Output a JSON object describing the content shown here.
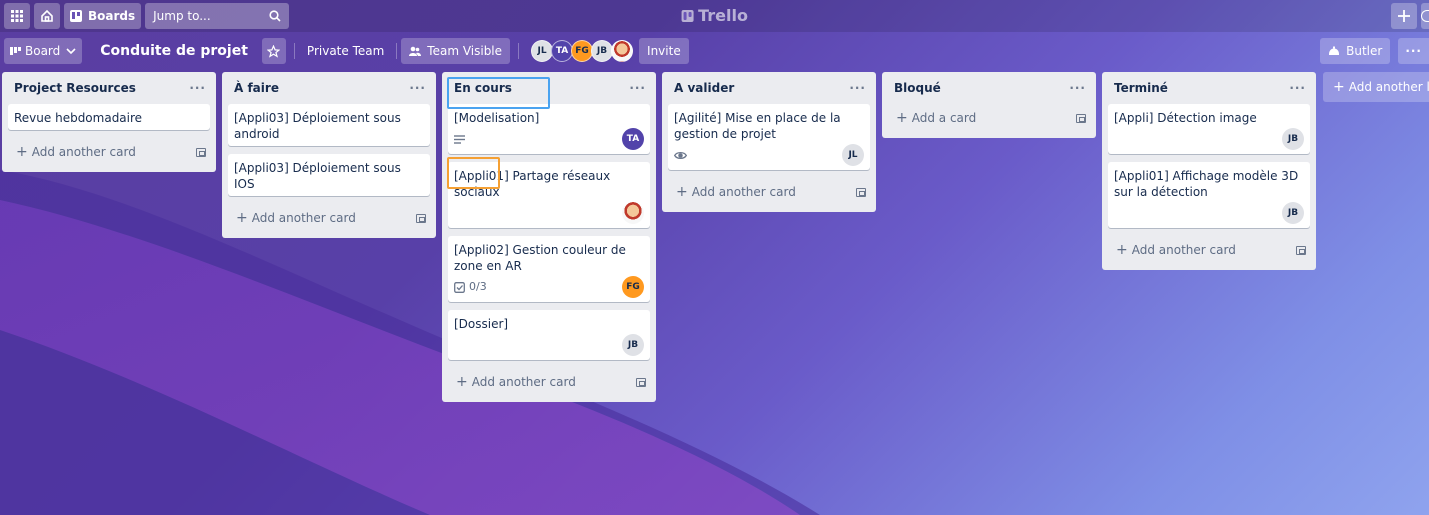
{
  "topbar": {
    "boards_label": "Boards",
    "search_placeholder": "Jump to...",
    "logo_text": "Trello"
  },
  "board": {
    "view_label": "Board",
    "title": "Conduite de projet",
    "team_label": "Private Team",
    "visibility_label": "Team Visible",
    "invite_label": "Invite",
    "butler_label": "Butler",
    "members": [
      "JL",
      "TA",
      "FG",
      "JB"
    ]
  },
  "lists": [
    {
      "title": "Project Resources",
      "cards": [
        {
          "title": "Revue hebdomadaire"
        }
      ],
      "add_label": "Add another card"
    },
    {
      "title": "À faire",
      "cards": [
        {
          "title": "[Appli03] Déploiement sous android"
        },
        {
          "title": "[Appli03] Déploiement sous IOS"
        }
      ],
      "add_label": "Add another card"
    },
    {
      "title": "En cours",
      "cards": [
        {
          "title": "[Modelisation]",
          "member": "TA"
        },
        {
          "title": "[Appli01] Partage réseaux sociaux"
        },
        {
          "title": "[Appli02] Gestion couleur de zone en AR",
          "checklist": "0/3",
          "member": "FG"
        },
        {
          "title": "[Dossier]",
          "member": "JB"
        }
      ],
      "add_label": "Add another card"
    },
    {
      "title": "A valider",
      "cards": [
        {
          "title": "[Agilité] Mise en place de la gestion de projet",
          "member": "JL"
        }
      ],
      "add_label": "Add another card"
    },
    {
      "title": "Bloqué",
      "cards": [],
      "add_label": "Add a card"
    },
    {
      "title": "Terminé",
      "cards": [
        {
          "title": "[Appli] Détection image",
          "member": "JB"
        },
        {
          "title": "[Appli01] Affichage modèle 3D sur la détection",
          "member": "JB"
        }
      ],
      "add_label": "Add another card"
    }
  ],
  "add_list_label": "Add another list",
  "colors": {
    "accent_blue": "#4aa3f0",
    "accent_orange": "#f5a033",
    "list_bg": "#ebecf0"
  }
}
